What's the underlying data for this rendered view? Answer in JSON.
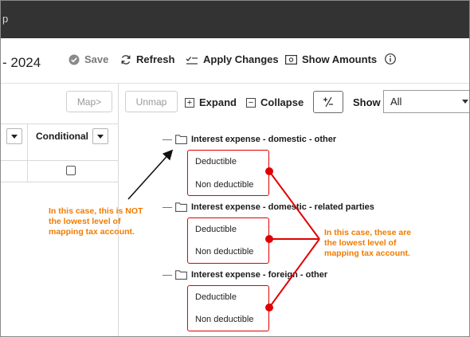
{
  "window": {
    "title_fragment": "p"
  },
  "toolbar": {
    "year_fragment": "- 2024",
    "save_label": "Save",
    "refresh_label": "Refresh",
    "apply_changes_label": "Apply Changes",
    "show_amounts_label": "Show Amounts"
  },
  "row2": {
    "map_label": "Map>",
    "unmap_label": "Unmap",
    "expand_label": "Expand",
    "collapse_label": "Collapse",
    "plus_minus_label": "+⁄−",
    "show_label": "Show",
    "show_value": "All"
  },
  "grid": {
    "conditional_header": "Conditional"
  },
  "tree": {
    "groups": [
      {
        "label": "Interest expense - domestic - other",
        "children": [
          "Deductible",
          "Non deductible"
        ]
      },
      {
        "label": "Interest expense - domestic - related parties",
        "children": [
          "Deductible",
          "Non deductible"
        ]
      },
      {
        "label": "Interest expense - foreign - other",
        "children": [
          "Deductible",
          "Non deductible"
        ]
      }
    ]
  },
  "annotations": {
    "left": [
      "In this case, this is NOT",
      "the lowest level of",
      "mapping tax account."
    ],
    "right": [
      "In this case, these are",
      "the lowest level of",
      "mapping tax account."
    ]
  },
  "colors": {
    "annotation_text": "#f07b00",
    "annotation_highlight": "#e00000",
    "titlebar": "#333333"
  }
}
